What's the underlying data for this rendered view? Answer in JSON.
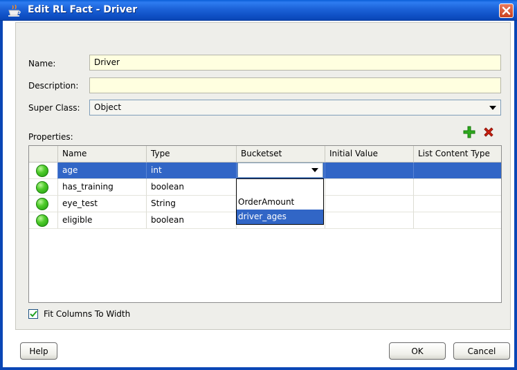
{
  "window": {
    "title": "Edit RL Fact - Driver"
  },
  "form": {
    "name_label": "Name:",
    "name_value": "Driver",
    "description_label": "Description:",
    "description_value": "",
    "superclass_label": "Super Class:",
    "superclass_value": "Object",
    "properties_label": "Properties:"
  },
  "table": {
    "columns": [
      "Name",
      "Type",
      "Bucketset",
      "Initial Value",
      "List Content Type"
    ],
    "rows": [
      {
        "name": "age",
        "type": "int",
        "bucketset": "",
        "initial": "",
        "list_type": "",
        "selected": true
      },
      {
        "name": "has_training",
        "type": "boolean",
        "bucketset": "",
        "initial": "",
        "list_type": ""
      },
      {
        "name": "eye_test",
        "type": "String",
        "bucketset": "",
        "initial": "",
        "list_type": ""
      },
      {
        "name": "eligible",
        "type": "boolean",
        "bucketset": "",
        "initial": "",
        "list_type": ""
      }
    ]
  },
  "bucketset_dropdown": {
    "options": [
      "",
      "OrderAmount",
      "driver_ages"
    ],
    "highlighted": "driver_ages"
  },
  "options": {
    "fit_columns_label": "Fit Columns To Width",
    "fit_columns_checked": true
  },
  "buttons": {
    "help": "Help",
    "ok": "OK",
    "cancel": "Cancel"
  },
  "icons": {
    "title": "coffee-cup-icon",
    "add": "plus-icon",
    "delete": "delete-x-icon",
    "close": "close-icon",
    "row_status": "green-ball-icon"
  },
  "colors": {
    "title_bar": "#1c62d8",
    "selection": "#3166c6",
    "field_bg": "#ffffe0",
    "add_icon": "#2faa1f",
    "delete_icon": "#d02010"
  }
}
